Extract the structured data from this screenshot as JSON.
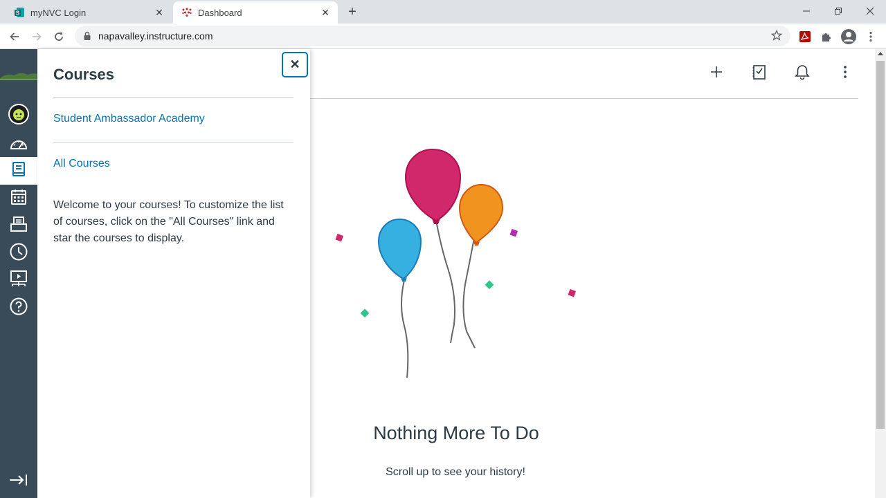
{
  "browser": {
    "tabs": [
      {
        "title": "myNVC Login",
        "favicon": "sharepoint-icon"
      },
      {
        "title": "Dashboard",
        "favicon": "canvas-icon"
      }
    ],
    "url": "napavalley.instructure.com"
  },
  "global_nav": {
    "items": [
      {
        "name": "account",
        "icon": "avatar-icon"
      },
      {
        "name": "dashboard",
        "icon": "dashboard-icon"
      },
      {
        "name": "courses",
        "icon": "book-icon",
        "active": true
      },
      {
        "name": "calendar",
        "icon": "calendar-icon"
      },
      {
        "name": "inbox",
        "icon": "inbox-icon"
      },
      {
        "name": "history",
        "icon": "clock-icon"
      },
      {
        "name": "commons",
        "icon": "commons-icon"
      },
      {
        "name": "help",
        "icon": "help-icon"
      }
    ],
    "accent_color": "#394b58"
  },
  "courses_tray": {
    "title": "Courses",
    "course_link": "Student Ambassador Academy",
    "all_courses_link": "All Courses",
    "welcome_text": "Welcome to your courses! To customize the list of courses, click on the \"All Courses\" link and star the courses to display.",
    "link_color": "#0374b5"
  },
  "main": {
    "empty_title": "Nothing More To Do",
    "empty_subtitle": "Scroll up to see your history!",
    "header_icons": [
      "plus-icon",
      "todo-icon",
      "bell-icon",
      "kebab-icon"
    ]
  }
}
